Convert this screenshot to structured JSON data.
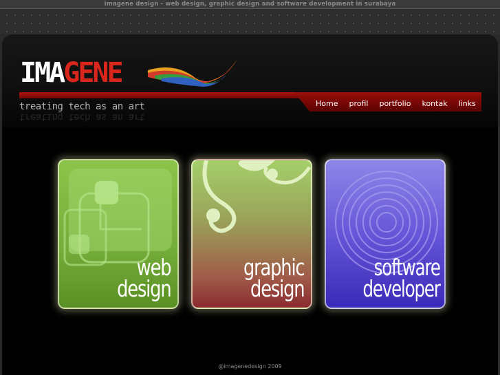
{
  "site_caption": "imagene design - web design, graphic design and software development in surabaya",
  "logo": {
    "part1": "IMA",
    "part2": "GENE"
  },
  "tagline": "treating tech as an art",
  "nav": {
    "home": "Home",
    "profil": "profil",
    "portfolio": "portfolio",
    "kontak": "kontak",
    "links": "links"
  },
  "cards": {
    "web": {
      "line1": "web",
      "line2": "design"
    },
    "graphic": {
      "line1": "graphic",
      "line2": "design"
    },
    "software": {
      "line1": "software",
      "line2": "developer"
    }
  },
  "footer": "@imagenedesign 2009",
  "colors": {
    "accent_red": "#b01410",
    "web_green": "#7ab640",
    "graphic_gradient": "#9aa35a",
    "software_purple": "#6656d8"
  },
  "icons": [
    "dot-pattern",
    "logo-swoosh"
  ]
}
